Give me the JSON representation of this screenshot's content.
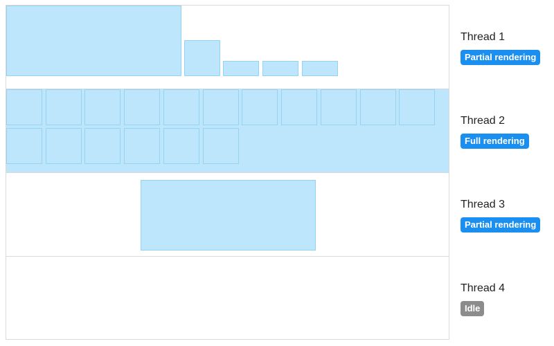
{
  "threads": [
    {
      "label": "Thread 1",
      "status": "Partial rendering",
      "status_color": "#1b8ff0"
    },
    {
      "label": "Thread 2",
      "status": "Full rendering",
      "status_color": "#1b8ff0"
    },
    {
      "label": "Thread 3",
      "status": "Partial rendering",
      "status_color": "#1b8ff0"
    },
    {
      "label": "Thread 4",
      "status": "Idle",
      "status_color": "#8c8c8c"
    }
  ],
  "colors": {
    "tile_fill": "#bde6fd",
    "tile_border": "#95d3f2",
    "frame_border": "#d9d9d9"
  }
}
